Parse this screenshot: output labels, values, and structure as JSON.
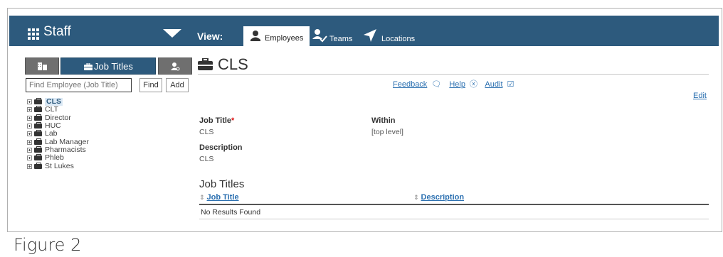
{
  "header": {
    "app_title": "Staff",
    "view_label": "View:",
    "tabs": [
      {
        "label": "Employees",
        "active": true
      },
      {
        "label": "Teams",
        "active": false
      },
      {
        "label": "Locations",
        "active": false
      }
    ]
  },
  "left_panel": {
    "mode_buttons": [
      {
        "icon": "building-icon"
      },
      {
        "label": "Job Titles",
        "icon": "briefcase-icon",
        "active": true
      },
      {
        "icon": "person-pin-icon"
      }
    ],
    "search": {
      "placeholder": "Find Employee (Job Title)",
      "value": ""
    },
    "find_label": "Find",
    "add_label": "Add",
    "tree": [
      {
        "label": "CLS",
        "selected": true
      },
      {
        "label": "CLT"
      },
      {
        "label": "Director"
      },
      {
        "label": "HUC"
      },
      {
        "label": "Lab"
      },
      {
        "label": "Lab Manager"
      },
      {
        "label": "Pharmacists"
      },
      {
        "label": "Phleb"
      },
      {
        "label": "St Lukes"
      }
    ]
  },
  "main": {
    "title": "CLS",
    "links": {
      "feedback": "Feedback",
      "help": "Help",
      "audit": "Audit"
    },
    "edit": "Edit",
    "fields": {
      "job_title_label": "Job Title",
      "job_title_required": "*",
      "job_title_value": "CLS",
      "within_label": "Within",
      "within_value": "[top level]",
      "description_label": "Description",
      "description_value": "CLS"
    },
    "section_title": "Job Titles",
    "table": {
      "columns": [
        "Job Title",
        "Description"
      ],
      "empty_text": "No Results Found"
    }
  },
  "caption": "Figure 2",
  "colors": {
    "header_bg": "#2d5a7d",
    "link": "#2a6fb0",
    "required": "#dd1111"
  }
}
